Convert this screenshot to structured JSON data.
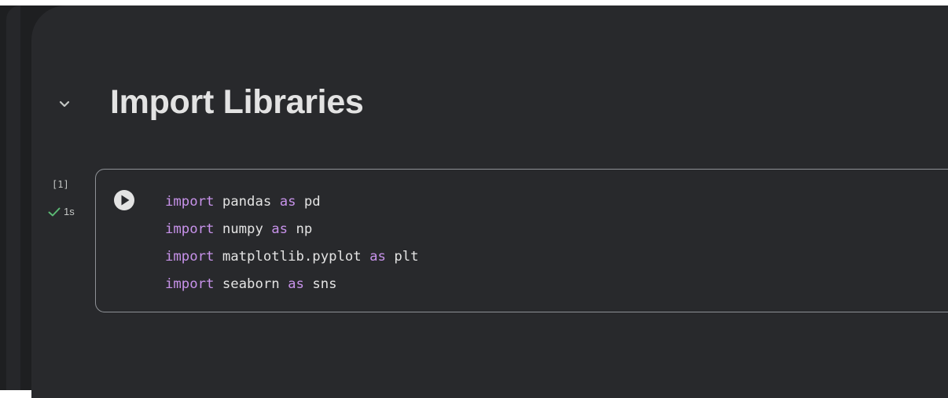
{
  "section": {
    "title": "Import Libraries",
    "collapse_icon": "chevron-down-icon"
  },
  "cell": {
    "execution_count": "[1]",
    "status_icon": "check-icon",
    "status_color": "#5bb974",
    "duration": "1s",
    "run_icon": "play-circle-icon",
    "lines": [
      {
        "kw1": "import",
        "module": "pandas",
        "kw2": "as",
        "alias": "pd"
      },
      {
        "kw1": "import",
        "module": "numpy",
        "kw2": "as",
        "alias": "np"
      },
      {
        "kw1": "import",
        "module": "matplotlib.pyplot",
        "kw2": "as",
        "alias": "plt"
      },
      {
        "kw1": "import",
        "module": "seaborn",
        "kw2": "as",
        "alias": "sns"
      }
    ]
  },
  "colors": {
    "keyword": "#c792ea",
    "text": "#e3e3e3",
    "panel_bg": "#28292c",
    "cell_border": "#8e9196"
  }
}
